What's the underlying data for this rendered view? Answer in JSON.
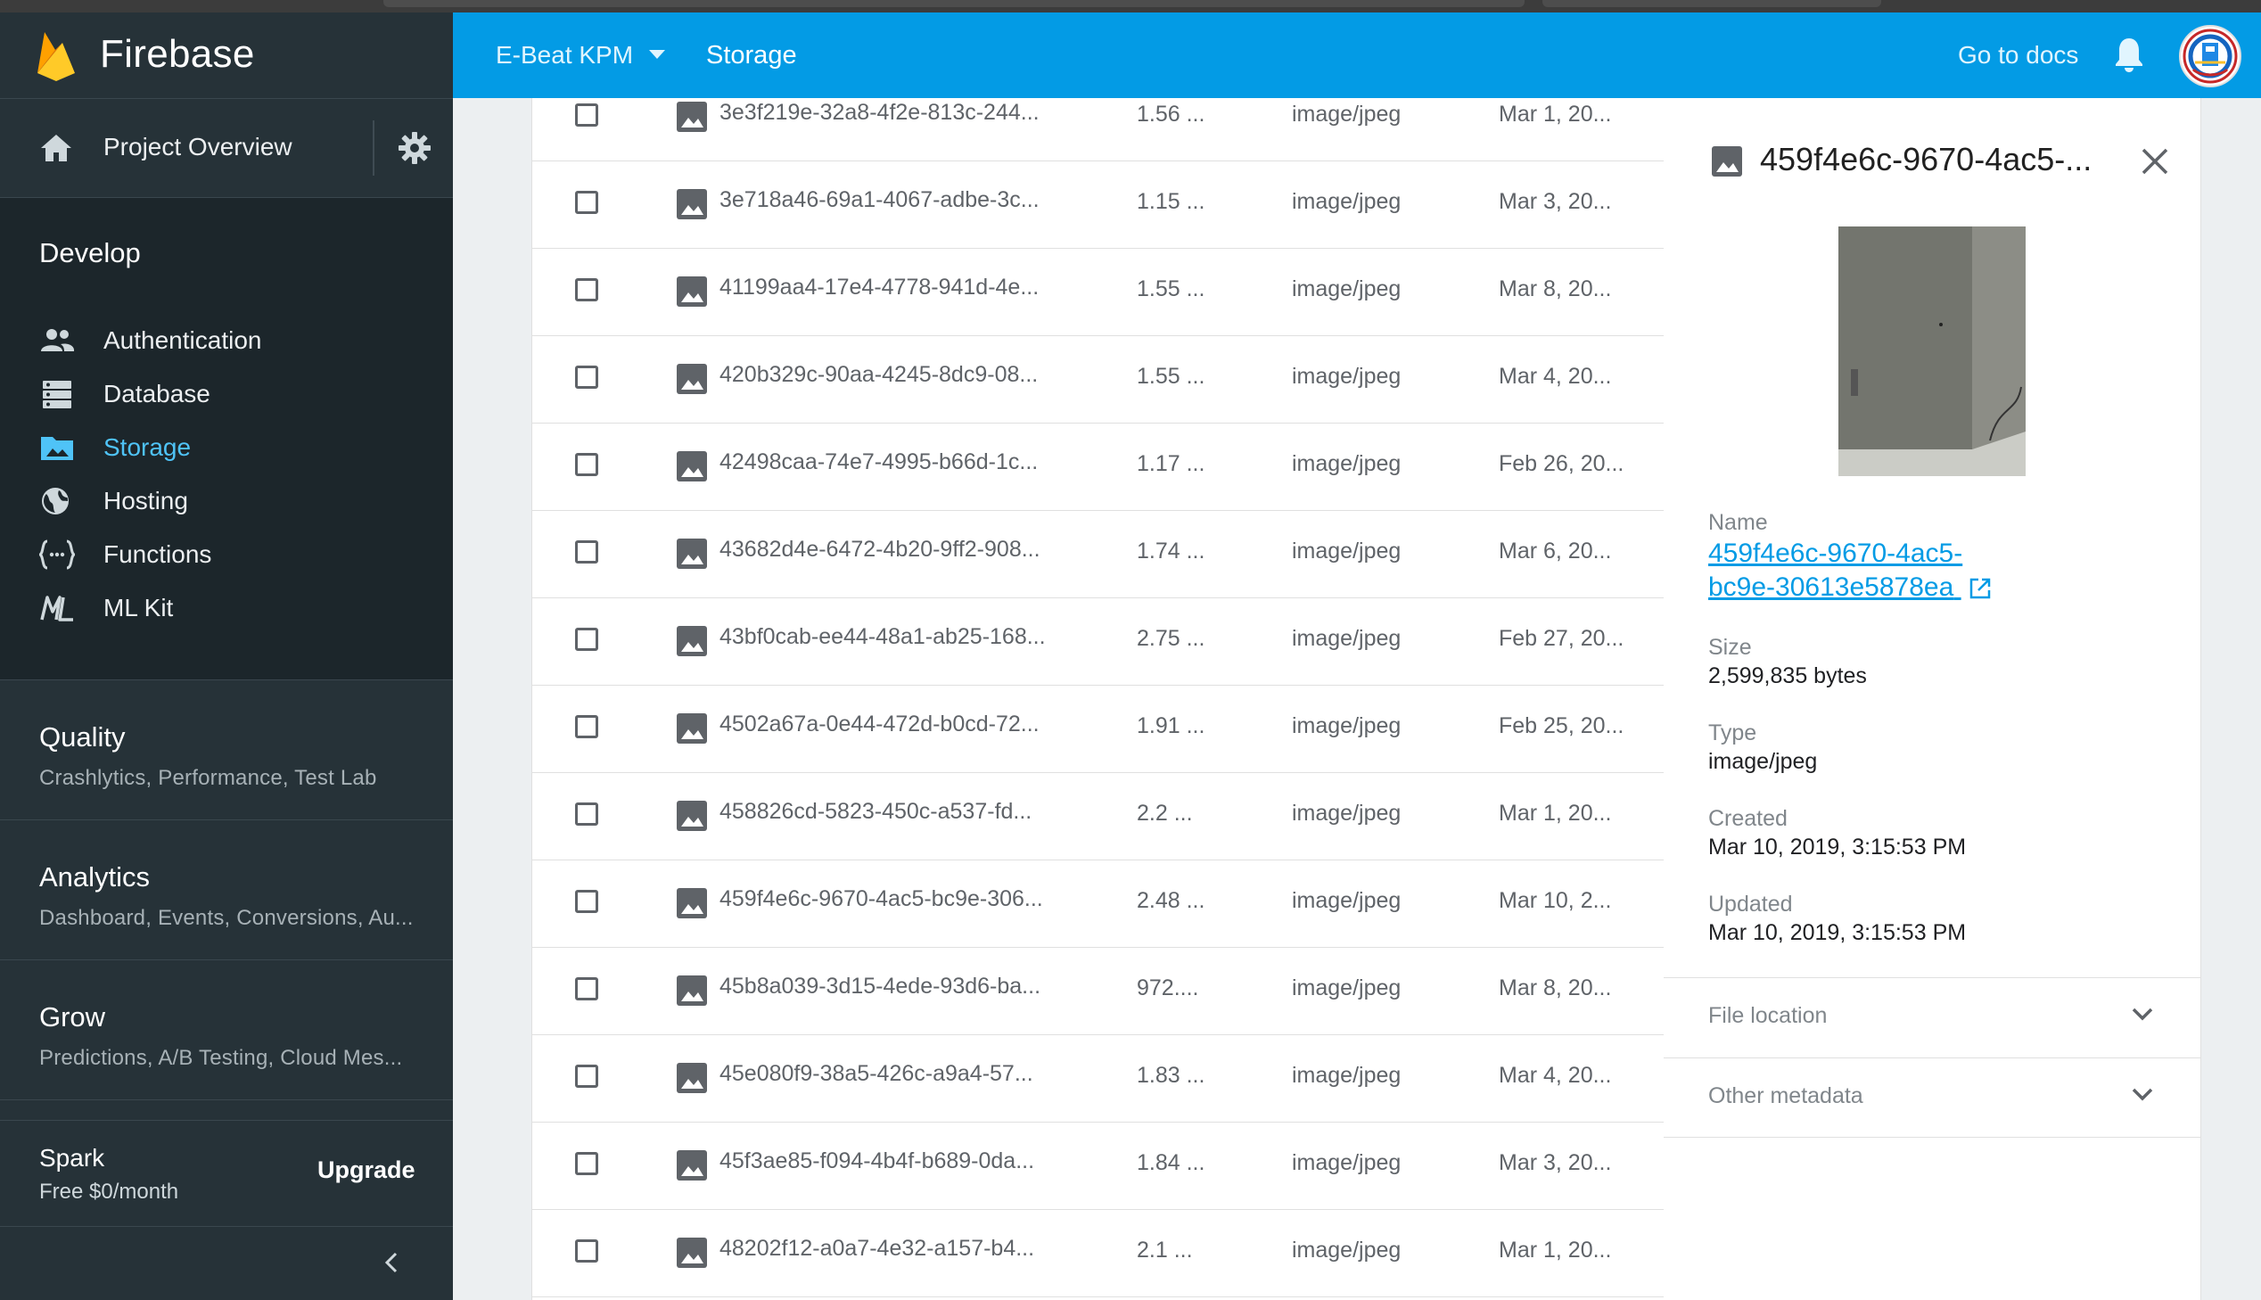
{
  "app": {
    "name": "Firebase"
  },
  "sidebar": {
    "overview_label": "Project Overview",
    "develop_heading": "Develop",
    "develop_items": [
      {
        "label": "Authentication",
        "icon": "people-icon"
      },
      {
        "label": "Database",
        "icon": "database-icon"
      },
      {
        "label": "Storage",
        "icon": "storage-icon",
        "active": true
      },
      {
        "label": "Hosting",
        "icon": "globe-icon"
      },
      {
        "label": "Functions",
        "icon": "functions-icon"
      },
      {
        "label": "ML Kit",
        "icon": "ml-kit-icon"
      }
    ],
    "sections": [
      {
        "heading": "Quality",
        "sub": "Crashlytics, Performance, Test Lab"
      },
      {
        "heading": "Analytics",
        "sub": "Dashboard, Events, Conversions, Au..."
      },
      {
        "heading": "Grow",
        "sub": "Predictions, A/B Testing, Cloud Mes..."
      }
    ],
    "plan": {
      "name": "Spark",
      "price": "Free $0/month",
      "upgrade_label": "Upgrade"
    }
  },
  "topbar": {
    "project": "E-Beat KPM",
    "page": "Storage",
    "docs_link": "Go to docs",
    "accent": "#039be5"
  },
  "files": [
    {
      "name": "3e3f219e-32a8-4f2e-813c-244...",
      "size": "1.56 ...",
      "type": "image/jpeg",
      "date": "Mar 1, 20..."
    },
    {
      "name": "3e718a46-69a1-4067-adbe-3c...",
      "size": "1.15 ...",
      "type": "image/jpeg",
      "date": "Mar 3, 20..."
    },
    {
      "name": "41199aa4-17e4-4778-941d-4e...",
      "size": "1.55 ...",
      "type": "image/jpeg",
      "date": "Mar 8, 20..."
    },
    {
      "name": "420b329c-90aa-4245-8dc9-08...",
      "size": "1.55 ...",
      "type": "image/jpeg",
      "date": "Mar 4, 20..."
    },
    {
      "name": "42498caa-74e7-4995-b66d-1c...",
      "size": "1.17 ...",
      "type": "image/jpeg",
      "date": "Feb 26, 20..."
    },
    {
      "name": "43682d4e-6472-4b20-9ff2-908...",
      "size": "1.74 ...",
      "type": "image/jpeg",
      "date": "Mar 6, 20..."
    },
    {
      "name": "43bf0cab-ee44-48a1-ab25-168...",
      "size": "2.75 ...",
      "type": "image/jpeg",
      "date": "Feb 27, 20..."
    },
    {
      "name": "4502a67a-0e44-472d-b0cd-72...",
      "size": "1.91 ...",
      "type": "image/jpeg",
      "date": "Feb 25, 20..."
    },
    {
      "name": "458826cd-5823-450c-a537-fd...",
      "size": "2.2 ...",
      "type": "image/jpeg",
      "date": "Mar 1, 20..."
    },
    {
      "name": "459f4e6c-9670-4ac5-bc9e-306...",
      "size": "2.48 ...",
      "type": "image/jpeg",
      "date": "Mar 10, 2..."
    },
    {
      "name": "45b8a039-3d15-4ede-93d6-ba...",
      "size": "972....",
      "type": "image/jpeg",
      "date": "Mar 8, 20..."
    },
    {
      "name": "45e080f9-38a5-426c-a9a4-57...",
      "size": "1.83 ...",
      "type": "image/jpeg",
      "date": "Mar 4, 20..."
    },
    {
      "name": "45f3ae85-f094-4b4f-b689-0da...",
      "size": "1.84 ...",
      "type": "image/jpeg",
      "date": "Mar 3, 20..."
    },
    {
      "name": "48202f12-a0a7-4e32-a157-b4...",
      "size": "2.1 ...",
      "type": "image/jpeg",
      "date": "Mar 1, 20..."
    }
  ],
  "details": {
    "title": "459f4e6c-9670-4ac5-...",
    "name_label": "Name",
    "name_line1": "459f4e6c-9670-4ac5-",
    "name_line2": "bc9e-30613e5878ea",
    "size_label": "Size",
    "size_value": "2,599,835 bytes",
    "type_label": "Type",
    "type_value": "image/jpeg",
    "created_label": "Created",
    "created_value": "Mar 10, 2019, 3:15:53 PM",
    "updated_label": "Updated",
    "updated_value": "Mar 10, 2019, 3:15:53 PM",
    "file_location_label": "File location",
    "other_metadata_label": "Other metadata"
  }
}
